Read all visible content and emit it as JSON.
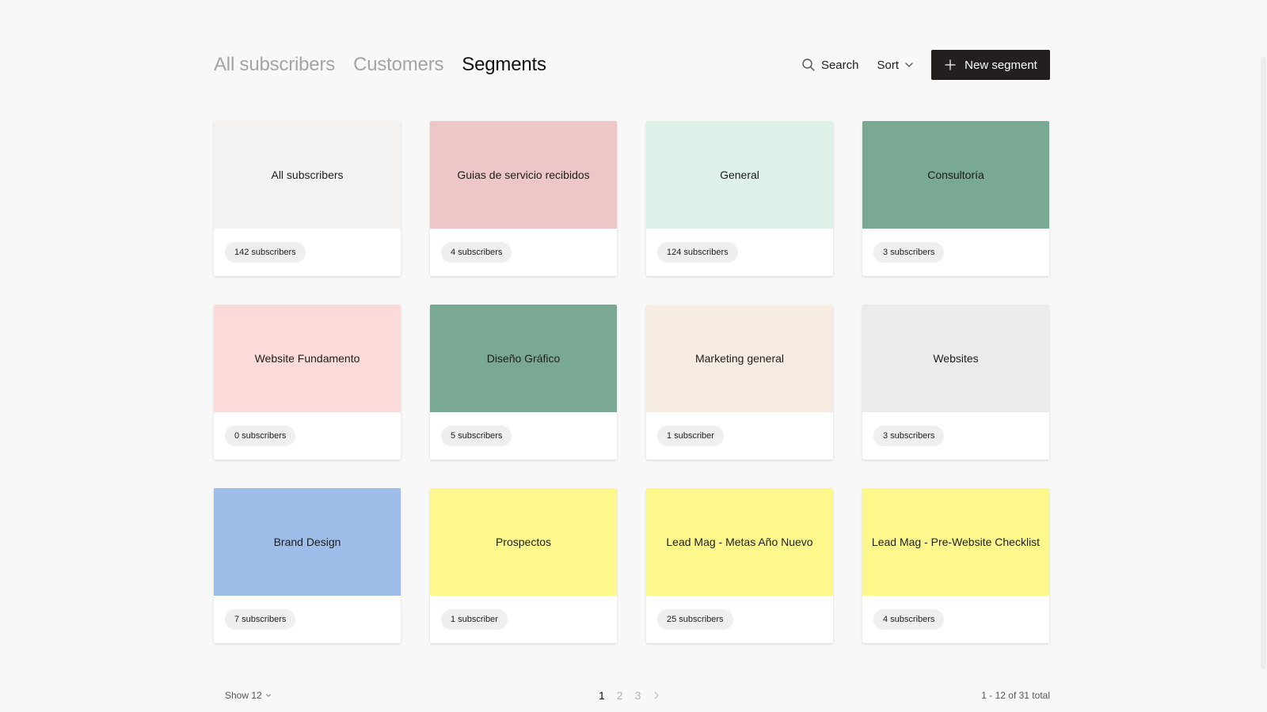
{
  "tabs": [
    {
      "label": "All subscribers",
      "active": false
    },
    {
      "label": "Customers",
      "active": false
    },
    {
      "label": "Segments",
      "active": true
    }
  ],
  "toolbar": {
    "search_label": "Search",
    "search_icon": "search-icon",
    "sort_label": "Sort",
    "sort_icon": "chevron-down-icon",
    "new_segment_label": "New segment",
    "new_segment_icon": "plus-icon"
  },
  "segments": [
    {
      "title": "All subscribers",
      "count": "142 subscribers",
      "color": "#f3f2f1"
    },
    {
      "title": "Guias de servicio recibidos",
      "count": "4 subscribers",
      "color": "#edc6c8"
    },
    {
      "title": "General",
      "count": "124 subscribers",
      "color": "#ddf1e8"
    },
    {
      "title": "Consultoría",
      "count": "3 subscribers",
      "color": "#7aa993"
    },
    {
      "title": "Website Fundamento",
      "count": "0 subscribers",
      "color": "#fbdbd9"
    },
    {
      "title": "Diseño Gráfico",
      "count": "5 subscribers",
      "color": "#7aa993"
    },
    {
      "title": "Marketing general",
      "count": "1 subscriber",
      "color": "#f7ece2"
    },
    {
      "title": "Websites",
      "count": "3 subscribers",
      "color": "#ebebeb"
    },
    {
      "title": "Brand Design",
      "count": "7 subscribers",
      "color": "#9ebde9"
    },
    {
      "title": "Prospectos",
      "count": "1 subscriber",
      "color": "#fdf88c"
    },
    {
      "title": "Lead Mag - Metas Año Nuevo",
      "count": "25 subscribers",
      "color": "#fdf88c"
    },
    {
      "title": "Lead Mag - Pre-Website Checklist",
      "count": "4 subscribers",
      "color": "#fdf88c"
    }
  ],
  "footer": {
    "show_label": "Show 12",
    "pages": [
      "1",
      "2",
      "3"
    ],
    "current_page": "1",
    "total_label": "1 - 12 of 31 total"
  },
  "colors": {
    "button_background": "#231f1f",
    "active_tab": "#111111",
    "inactive_tab": "#a4a4a4",
    "page_background": "#f8f8f8"
  }
}
